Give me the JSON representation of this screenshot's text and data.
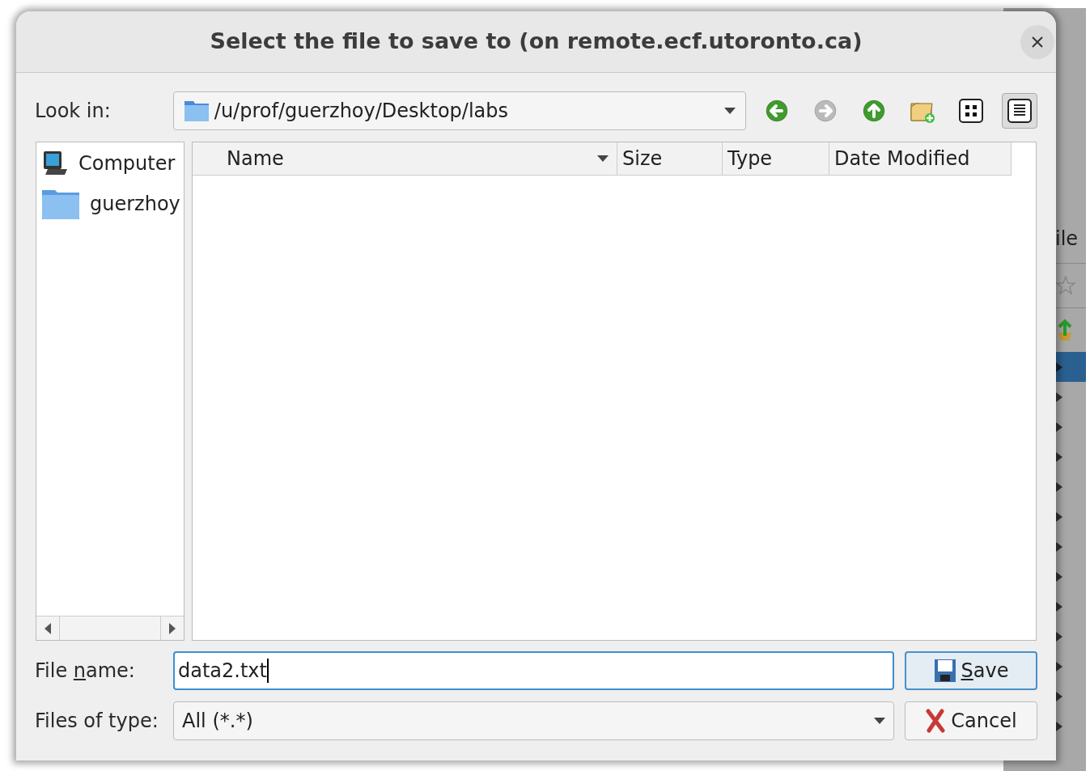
{
  "dialog": {
    "title": "Select the file to save to (on remote.ecf.utoronto.ca)",
    "look_in": {
      "label": "Look in:",
      "path": "/u/prof/guerzhoy/Desktop/labs"
    },
    "toolbar": [
      {
        "kind": "back",
        "disabled": false
      },
      {
        "kind": "forward",
        "disabled": true
      },
      {
        "kind": "up",
        "disabled": false
      },
      {
        "kind": "new-folder",
        "disabled": false
      },
      {
        "kind": "icon-view",
        "selected": false
      },
      {
        "kind": "detail-view",
        "selected": true
      }
    ],
    "places": [
      {
        "kind": "computer",
        "label": "Computer"
      },
      {
        "kind": "folder",
        "label": "guerzhoy"
      }
    ],
    "columns": [
      {
        "label": "Name",
        "sorted": true
      },
      {
        "label": "Size",
        "sorted": false
      },
      {
        "label": "Type",
        "sorted": false
      },
      {
        "label": "Date Modified",
        "sorted": false
      }
    ],
    "file_name": {
      "label_before": "File ",
      "mnemonic": "n",
      "label_after": "ame:",
      "value": "data2.txt"
    },
    "file_type": {
      "label": "Files of type:",
      "value": "All (*.*)"
    },
    "buttons": [
      {
        "kind": "save",
        "mnemonic": "S",
        "rest": "ave",
        "default": true
      },
      {
        "kind": "cancel",
        "rest": "Cancel",
        "default": false
      }
    ]
  },
  "background_window": {
    "partial_text": "ile",
    "rows": [
      {
        "selected": true
      },
      {
        "selected": false
      },
      {
        "selected": false
      },
      {
        "selected": false
      },
      {
        "selected": false
      },
      {
        "selected": false
      },
      {
        "selected": false
      },
      {
        "selected": false
      },
      {
        "selected": false
      },
      {
        "selected": false
      },
      {
        "selected": false
      },
      {
        "selected": false
      },
      {
        "selected": false
      }
    ]
  }
}
